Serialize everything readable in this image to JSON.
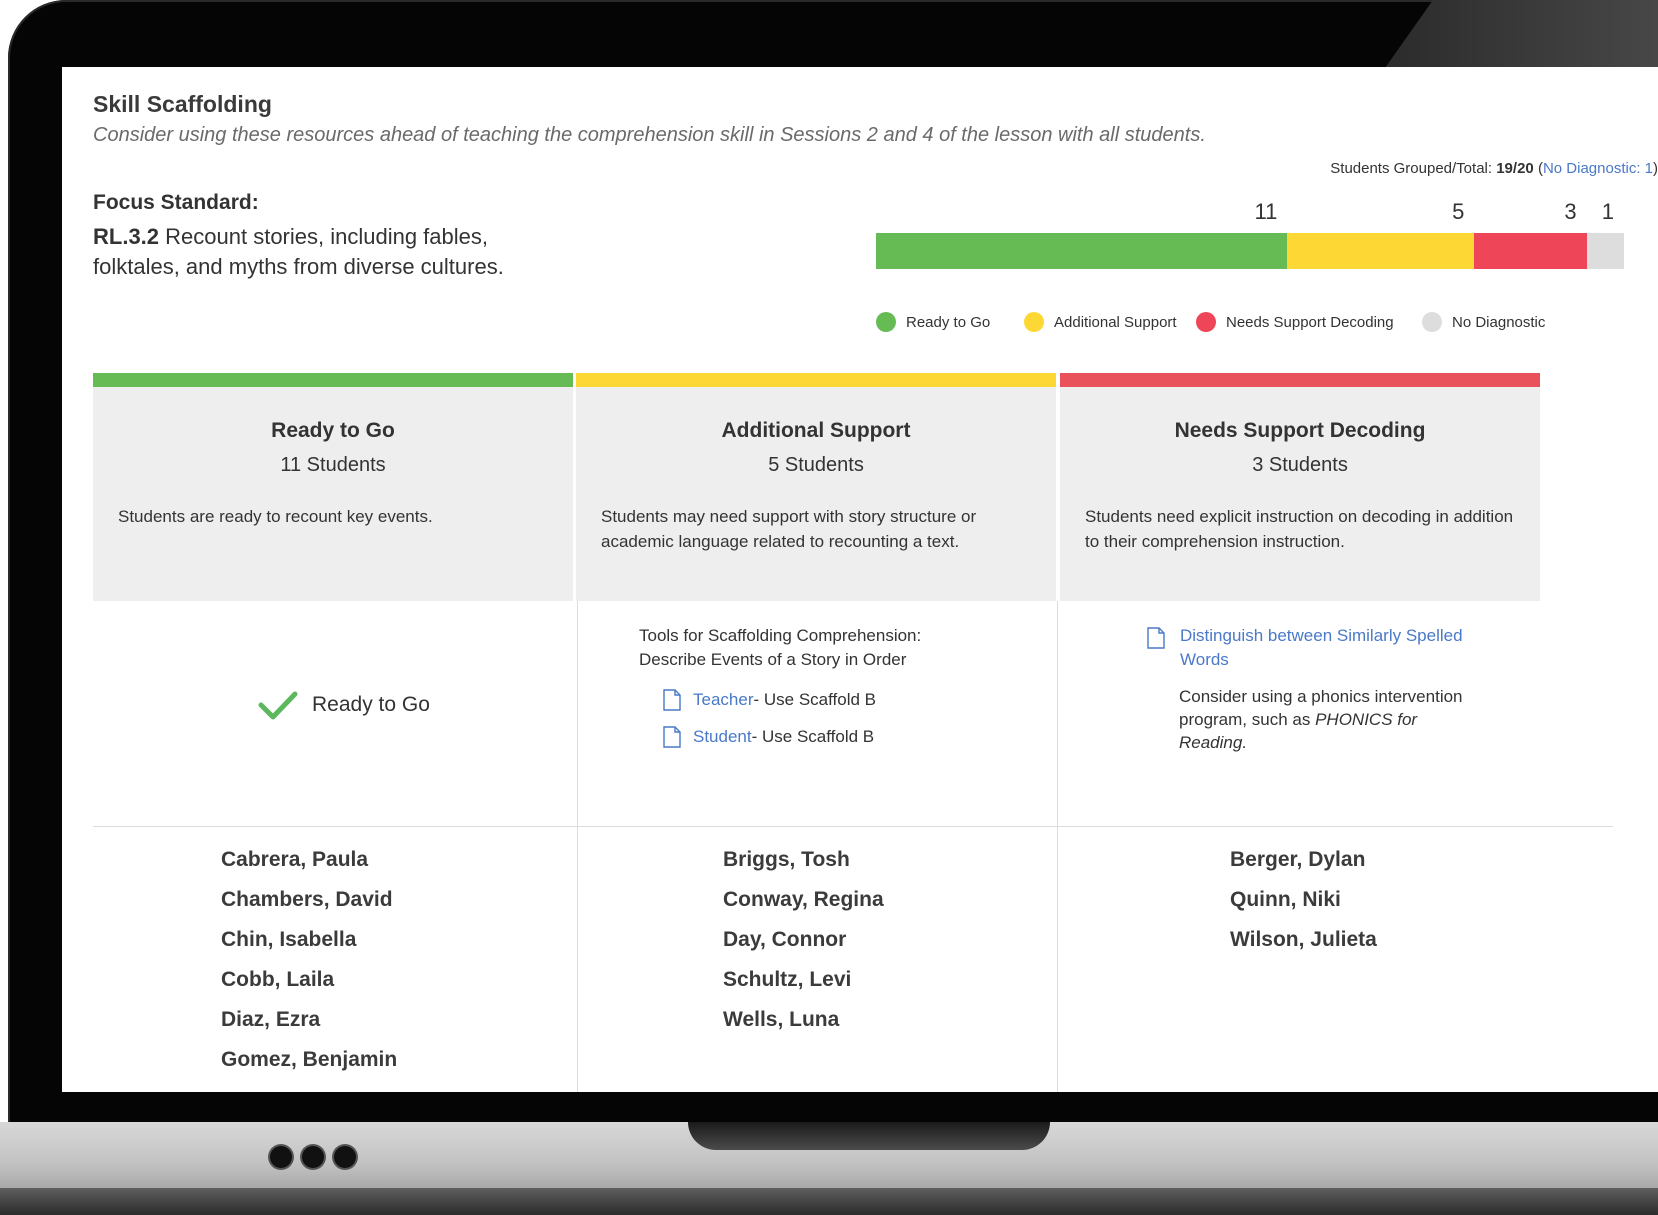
{
  "header": {
    "title": "Skill Scaffolding",
    "subtitle": "Consider using these resources ahead of teaching the comprehension skill in Sessions 2 and 4 of the lesson with all students."
  },
  "focus": {
    "label": "Focus Standard:",
    "code": "RL.3.2",
    "text": "Recount stories, including fables, folktales, and myths from diverse cultures."
  },
  "summary": {
    "grouped_label": "Students Grouped/Total:",
    "grouped_value": "19/20",
    "open_paren": "(",
    "no_diag_link": "No Diagnostic: 1",
    "close_paren": ")"
  },
  "chart_data": {
    "type": "bar",
    "orientation": "stacked-horizontal",
    "total": 20,
    "series": [
      {
        "name": "Ready to Go",
        "value": 11,
        "color": "#66bb55"
      },
      {
        "name": "Additional Support",
        "value": 5,
        "color": "#fdd835"
      },
      {
        "name": "Needs Support Decoding",
        "value": 3,
        "color": "#ef4558"
      },
      {
        "name": "No Diagnostic",
        "value": 1,
        "color": "#dddddd"
      }
    ]
  },
  "legend": [
    {
      "label": "Ready to Go",
      "color": "#66bb55"
    },
    {
      "label": "Additional Support",
      "color": "#fdd835"
    },
    {
      "label": "Needs Support Decoding",
      "color": "#ef4558"
    },
    {
      "label": "No Diagnostic",
      "color": "#dddddd"
    }
  ],
  "columns": [
    {
      "title": "Ready to Go",
      "count": "11 Students",
      "description": "Students are ready to recount key events.",
      "accent": "#66bb55",
      "status_label": "Ready to Go",
      "students": [
        "Cabrera, Paula",
        "Chambers, David",
        "Chin, Isabella",
        "Cobb, Laila",
        "Diaz, Ezra",
        "Gomez, Benjamin"
      ]
    },
    {
      "title": "Additional Support",
      "count": "5 Students",
      "description": "Students may need support with story structure or academic language related to recounting a text.",
      "accent": "#fdd835",
      "tools_line1": "Tools for Scaffolding Comprehension:",
      "tools_line2": "Describe Events of a Story in Order",
      "resources": [
        {
          "link": "Teacher",
          "suffix": " - Use Scaffold B"
        },
        {
          "link": "Student",
          "suffix": " - Use Scaffold B"
        }
      ],
      "students": [
        "Briggs, Tosh",
        "Conway, Regina",
        "Day, Connor",
        "Schultz, Levi",
        "Wells, Luna"
      ]
    },
    {
      "title": "Needs Support Decoding",
      "count": "3 Students",
      "description": "Students need explicit instruction on decoding in addition to their comprehension instruction.",
      "accent": "#e9525a",
      "resource_link": "Distinguish between Similarly Spelled Words",
      "note_prefix": "Consider using a phonics intervention program, such as",
      "note_italic": "PHONICS for Reading.",
      "students": [
        "Berger, Dylan",
        "Quinn, Niki",
        "Wilson, Julieta"
      ]
    }
  ]
}
